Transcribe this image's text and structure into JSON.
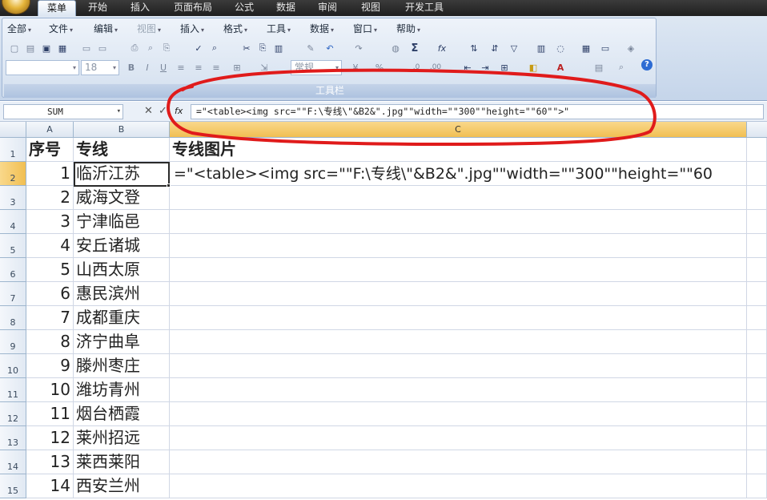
{
  "ribbon_tabs": [
    "菜单",
    "开始",
    "插入",
    "页面布局",
    "公式",
    "数据",
    "审阅",
    "视图",
    "开发工具"
  ],
  "menus": [
    "全部",
    "文件",
    "编辑",
    "视图",
    "插入",
    "格式",
    "工具",
    "数据",
    "窗口",
    "帮助"
  ],
  "toolbar": {
    "font_size": "18",
    "number_format": "常规",
    "group_label": "工具栏"
  },
  "formula_bar": {
    "name_box": "SUM",
    "cancel": "✕",
    "enter": "✓",
    "fx": "fx",
    "formula": "=\"<table><img src=\"\"F:\\专线\\\"&B2&\".jpg\"\"width=\"\"300\"\"height=\"\"60\"\">\""
  },
  "columns": [
    "A",
    "B",
    "C"
  ],
  "header_row": {
    "a": "序号",
    "b": "专线",
    "c": "专线图片"
  },
  "rows": [
    {
      "n": "1",
      "a": "1",
      "b": "临沂江苏"
    },
    {
      "n": "2",
      "a": "2",
      "b": "威海文登"
    },
    {
      "n": "3",
      "a": "3",
      "b": "宁津临邑"
    },
    {
      "n": "4",
      "a": "4",
      "b": "安丘诸城"
    },
    {
      "n": "5",
      "a": "5",
      "b": "山西太原"
    },
    {
      "n": "6",
      "a": "6",
      "b": "惠民滨州"
    },
    {
      "n": "7",
      "a": "7",
      "b": "成都重庆"
    },
    {
      "n": "8",
      "a": "8",
      "b": "济宁曲阜"
    },
    {
      "n": "9",
      "a": "9",
      "b": "滕州枣庄"
    },
    {
      "n": "10",
      "a": "10",
      "b": "潍坊青州"
    },
    {
      "n": "11",
      "a": "11",
      "b": "烟台栖霞"
    },
    {
      "n": "12",
      "a": "12",
      "b": "莱州招远"
    },
    {
      "n": "13",
      "a": "13",
      "b": "莱西莱阳"
    },
    {
      "n": "14",
      "a": "14",
      "b": "西安兰州"
    }
  ],
  "row_numbers": [
    "1",
    "2",
    "3",
    "4",
    "5",
    "6",
    "7",
    "8",
    "9",
    "10",
    "11",
    "12",
    "13",
    "14",
    "15"
  ],
  "c2_display": "=\"<table><img src=\"\"F:\\专线\\\"&B2&\".jpg\"\"width=\"\"300\"\"height=\"\"60",
  "colors": {
    "annotation": "#e01b1b",
    "selected_header": "#f1bf52"
  }
}
